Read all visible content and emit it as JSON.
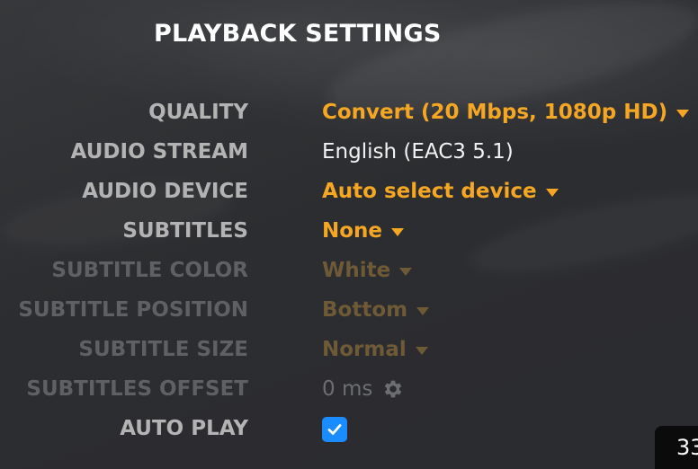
{
  "header": {
    "title": "PLAYBACK SETTINGS"
  },
  "settings": {
    "quality": {
      "label": "QUALITY",
      "value": "Convert (20 Mbps, 1080p HD)"
    },
    "audio_stream": {
      "label": "AUDIO STREAM",
      "value": "English (EAC3 5.1)"
    },
    "audio_device": {
      "label": "AUDIO DEVICE",
      "value": "Auto select device"
    },
    "subtitles": {
      "label": "SUBTITLES",
      "value": "None"
    },
    "subtitle_color": {
      "label": "SUBTITLE COLOR",
      "value": "White",
      "disabled": true
    },
    "subtitle_position": {
      "label": "SUBTITLE POSITION",
      "value": "Bottom",
      "disabled": true
    },
    "subtitle_size": {
      "label": "SUBTITLE SIZE",
      "value": "Normal",
      "disabled": true
    },
    "subtitles_offset": {
      "label": "SUBTITLES OFFSET",
      "value": "0 ms",
      "icon": "gear-icon",
      "disabled": true
    },
    "auto_play": {
      "label": "AUTO PLAY",
      "checked": true,
      "icon": "checkmark-icon"
    }
  },
  "overlay": {
    "counter": "33"
  },
  "colors": {
    "accent": "#f5a623",
    "checkbox": "#1a8cff",
    "label": "#b3b3b3",
    "disabled_label": "#5e6064",
    "disabled_value": "#6e5a36",
    "background": "#2f3033"
  }
}
